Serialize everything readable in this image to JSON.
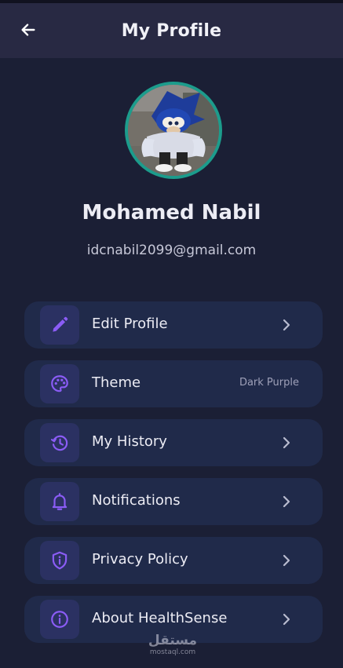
{
  "appbar": {
    "title": "My Profile",
    "back_icon": "arrow-left-icon"
  },
  "profile": {
    "name": "Mohamed Nabil",
    "email": "idcnabil2099@gmail.com",
    "avatar_ring_color": "#1c9c8c"
  },
  "menu": {
    "items": [
      {
        "label": "Edit Profile",
        "icon": "pencil-icon",
        "trailing": "chevron-right-icon"
      },
      {
        "label": "Theme",
        "icon": "palette-icon",
        "value": "Dark Purple"
      },
      {
        "label": "My History",
        "icon": "history-icon",
        "trailing": "chevron-right-icon"
      },
      {
        "label": "Notifications",
        "icon": "bell-icon",
        "trailing": "chevron-right-icon"
      },
      {
        "label": "Privacy Policy",
        "icon": "shield-icon",
        "trailing": "chevron-right-icon"
      },
      {
        "label": "About HealthSense",
        "icon": "info-icon",
        "trailing": "chevron-right-icon"
      }
    ]
  },
  "watermark": {
    "arabic": "مستقل",
    "latin": "mostaql.com"
  },
  "colors": {
    "background": "#1b1f35",
    "appbar": "#282943",
    "card": "#202a4a",
    "icon_tile": "#2b3162",
    "accent": "#8b5cf6",
    "chevron": "#b9bbcf"
  }
}
